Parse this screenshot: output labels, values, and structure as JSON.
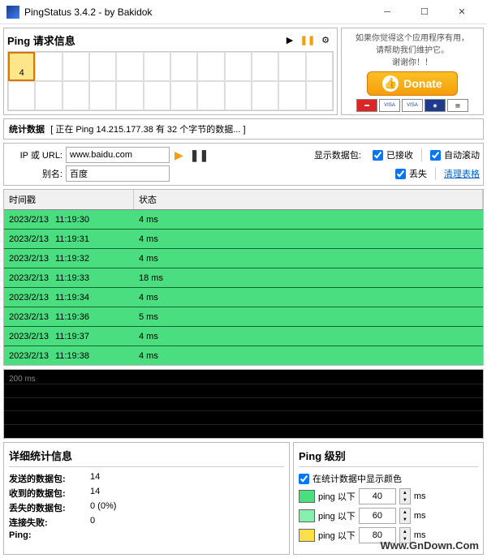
{
  "window": {
    "title": "PingStatus 3.4.2 - by Bakidok"
  },
  "request": {
    "label": "Ping 请求信息",
    "activeCell": "4"
  },
  "side": {
    "line1": "如果你觉得这个应用程序有用，",
    "line2": "请帮助我们维护它。",
    "line3": "谢谢你！！",
    "donate": "Donate"
  },
  "stats": {
    "prefix": "统计数据",
    "msg": "[ 正在 Ping 14.215.177.38 有 32 个字节的数据... ]"
  },
  "form": {
    "urlLabel": "IP 或 URL:",
    "urlValue": "www.baidu.com",
    "aliasLabel": "别名:",
    "aliasValue": "百度",
    "showPackets": "显示数据包:",
    "received": "已接收",
    "lost": "丢失",
    "autoscroll": "自动滚动",
    "clear": "清理表格"
  },
  "table": {
    "col1": "时间戳",
    "col2": "状态",
    "rows": [
      {
        "d": "2023/2/13",
        "t": "11:19:30",
        "s": "4 ms"
      },
      {
        "d": "2023/2/13",
        "t": "11:19:31",
        "s": "4 ms"
      },
      {
        "d": "2023/2/13",
        "t": "11:19:32",
        "s": "4 ms"
      },
      {
        "d": "2023/2/13",
        "t": "11:19:33",
        "s": "18 ms"
      },
      {
        "d": "2023/2/13",
        "t": "11:19:34",
        "s": "4 ms"
      },
      {
        "d": "2023/2/13",
        "t": "11:19:36",
        "s": "5 ms"
      },
      {
        "d": "2023/2/13",
        "t": "11:19:37",
        "s": "4 ms"
      },
      {
        "d": "2023/2/13",
        "t": "11:19:38",
        "s": "4 ms"
      }
    ]
  },
  "graph": {
    "ylabel": "200 ms"
  },
  "detail": {
    "header": "详细统计信息",
    "sentL": "发送的数据包:",
    "sentV": "14",
    "recvL": "收到的数据包:",
    "recvV": "14",
    "lostL": "丢失的数据包:",
    "lostV": "0 (0%)",
    "failL": "连接失败:",
    "failV": "0",
    "pingL": "Ping:"
  },
  "level": {
    "header": "Ping 级别",
    "showColor": "在统计数据中显示颜色",
    "belowL": "ping 以下",
    "ms": "ms",
    "r1": {
      "v": "40",
      "c": "#4ade80"
    },
    "r2": {
      "v": "60",
      "c": "#86efac"
    },
    "r3": {
      "v": "80",
      "c": "#fde047"
    }
  },
  "watermark": "Www.GnDown.Com"
}
